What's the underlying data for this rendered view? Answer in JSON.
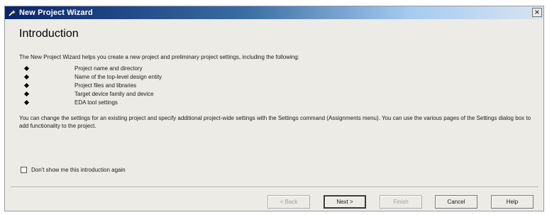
{
  "window": {
    "title": "New Project Wizard",
    "close_glyph": "×",
    "title_icon": "wizard-icon"
  },
  "heading": "Introduction",
  "intro_text": "The New Project Wizard helps you create a new project and preliminary project settings, including the following:",
  "bullets": [
    "Project name and directory",
    "Name of the top-level design entity",
    "Project files and libraries",
    "Target device family and device",
    "EDA tool settings"
  ],
  "description": "You can change the settings for an existing project and specify additional project-wide settings with the Settings command (Assignments menu). You can use the various pages of the Settings dialog box to add functionality to the project.",
  "checkbox": {
    "label": "Don't show me this introduction again",
    "checked": false
  },
  "buttons": {
    "back": "< Back",
    "next": "Next >",
    "finish": "Finish",
    "cancel": "Cancel",
    "help": "Help"
  }
}
